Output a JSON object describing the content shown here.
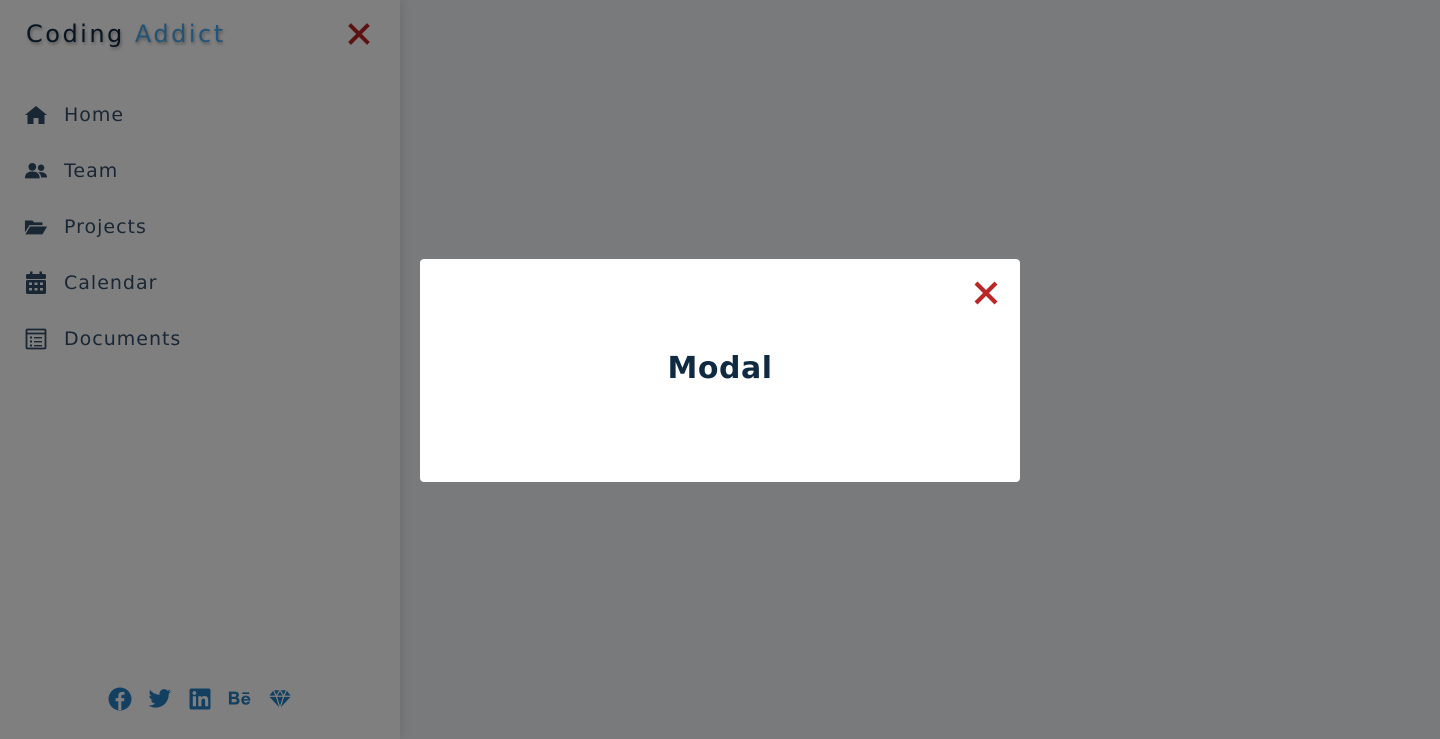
{
  "sidebar": {
    "logo_part1": "Coding ",
    "logo_part2": "Addict",
    "close_icon": "close-icon",
    "links": [
      {
        "label": "Home",
        "icon": "home-icon"
      },
      {
        "label": "Team",
        "icon": "users-icon"
      },
      {
        "label": "Projects",
        "icon": "folder-open-icon"
      },
      {
        "label": "Calendar",
        "icon": "calendar-icon"
      },
      {
        "label": "Documents",
        "icon": "document-icon"
      }
    ],
    "social": [
      {
        "icon": "facebook-icon"
      },
      {
        "icon": "twitter-icon"
      },
      {
        "icon": "linkedin-icon"
      },
      {
        "icon": "behance-icon"
      },
      {
        "icon": "sketch-icon"
      }
    ]
  },
  "modal": {
    "title": "Modal",
    "close_icon": "close-icon"
  },
  "colors": {
    "accent": "#49a6e9",
    "close": "#bb2525",
    "text": "#324d67",
    "title": "#102a42",
    "social": "#2680c0"
  }
}
